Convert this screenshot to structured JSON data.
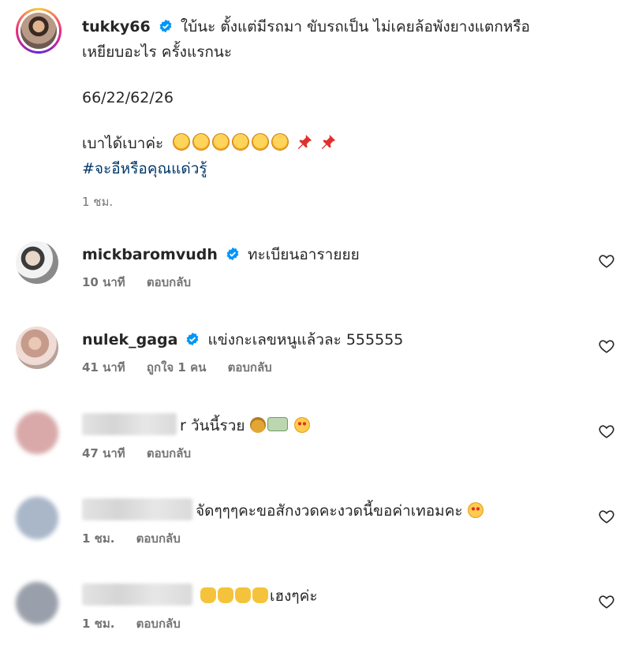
{
  "post": {
    "username": "tukky66",
    "caption_line1": "ใบ้นะ ตั้งแต่มีรถมา ขับรถเป็น ไม่เคยล้อพังยางแตกหรือ",
    "caption_line2": "เหยียบอะไร ครั้งแรกนะ",
    "numbers": "66/22/62/26",
    "caption_line3": "เบาได้เบาค่ะ",
    "hashtag": "#จะอีหรือคุณแด่วรู้",
    "time": "1 ชม."
  },
  "comments": [
    {
      "username": "mickbaromvudh",
      "text": "ทะเบียนอารายยย",
      "time": "10 นาที",
      "likes": "",
      "reply": "ตอบกลับ"
    },
    {
      "username": "nulek_gaga",
      "text": "แข่งกะเลขหนูแล้วละ 555555",
      "time": "41 นาที",
      "likes": "ถูกใจ 1 คน",
      "reply": "ตอบกลับ"
    },
    {
      "username": "",
      "text": "r วันนี้รวย",
      "time": "47 นาที",
      "likes": "",
      "reply": "ตอบกลับ"
    },
    {
      "username": "",
      "text": "จัดๆๆๆคะขอสักงวดคะงวดนี้ขอค่าเทอมคะ",
      "time": "1 ชม.",
      "likes": "",
      "reply": "ตอบกลับ"
    },
    {
      "username": "",
      "text": "เฮงๆค่ะ",
      "time": "1 ชม.",
      "likes": "",
      "reply": "ตอบกลับ"
    }
  ],
  "icons": {
    "verified": "verified-badge-icon",
    "heart": "heart-outline-icon"
  },
  "colors": {
    "verified": "#0095f6",
    "meta": "#737373",
    "hashtag": "#00376b"
  }
}
